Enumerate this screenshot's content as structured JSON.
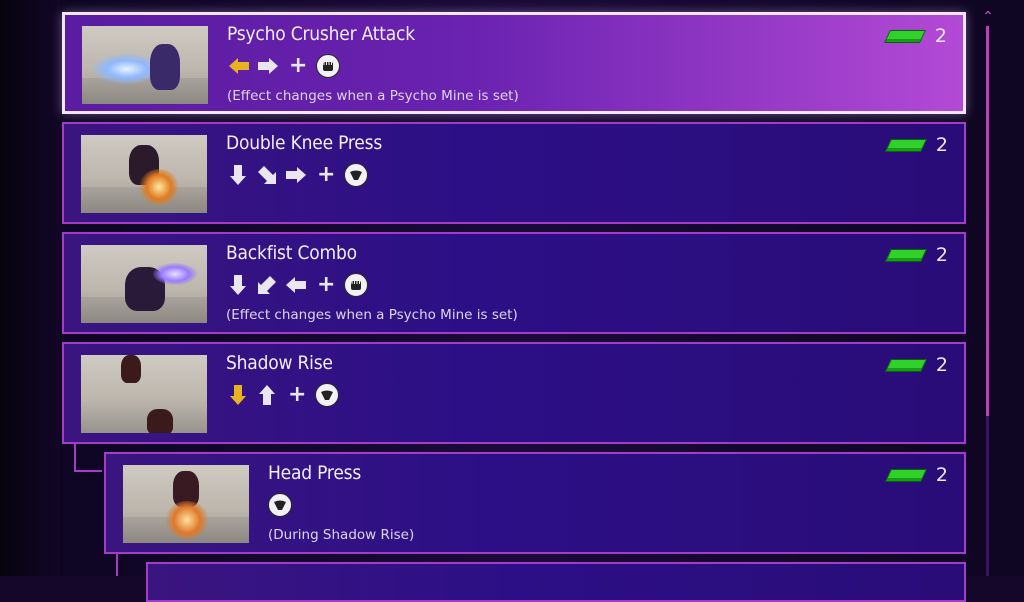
{
  "moves": [
    {
      "name": "Psycho Crusher Attack",
      "input_icons": [
        "arrow-left-held-icon",
        "arrow-right-icon"
      ],
      "button_icon": "punch-fist-icon",
      "note": "(Effect changes when a Psycho Mine is set)",
      "cost": "2",
      "selected": true
    },
    {
      "name": "Double Knee Press",
      "input_icons": [
        "arrow-down-icon",
        "arrow-down-right-icon",
        "arrow-right-icon"
      ],
      "button_icon": "kick-icon",
      "note": "",
      "cost": "2",
      "selected": false
    },
    {
      "name": "Backfist Combo",
      "input_icons": [
        "arrow-down-icon",
        "arrow-down-left-icon",
        "arrow-left-icon"
      ],
      "button_icon": "punch-fist-icon",
      "note": "(Effect changes when a Psycho Mine is set)",
      "cost": "2",
      "selected": false
    },
    {
      "name": "Shadow Rise",
      "input_icons": [
        "arrow-down-held-icon",
        "arrow-up-icon"
      ],
      "button_icon": "kick-icon",
      "note": "",
      "cost": "2",
      "selected": false
    },
    {
      "name": "Head Press",
      "input_icons": [],
      "button_icon": "kick-icon",
      "note": "(During Shadow Rise)",
      "cost": "2",
      "selected": false
    }
  ],
  "plus_sign": "+",
  "colors": {
    "accent": "#a53cc8",
    "gauge": "#30d22a",
    "held_arrow": "#e8b320",
    "arrow": "#e9e6ef"
  }
}
